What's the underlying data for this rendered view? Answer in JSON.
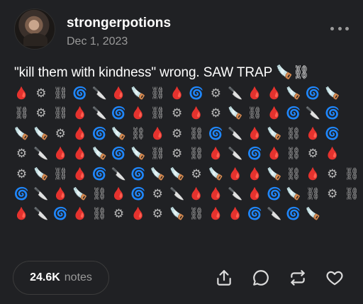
{
  "post": {
    "username": "strongerpotions",
    "date": "Dec 1, 2023",
    "text": "\"kill them with kindness\" wrong. SAW TRAP 🪚⛓",
    "emoji_legend": {
      "drop": "🩸",
      "gear": "⚙",
      "chain": "⛓",
      "spiral": "🌀",
      "knife": "🔪",
      "saw": "🪚"
    },
    "emoji_rows": [
      [
        "drop",
        "gear",
        "chain",
        "spiral",
        "knife",
        "drop",
        "saw",
        "chain",
        "drop",
        "spiral",
        "gear",
        "knife",
        "drop",
        "drop",
        "saw",
        "spiral",
        "saw"
      ],
      [
        "chain",
        "gear",
        "chain",
        "drop",
        "knife",
        "spiral",
        "drop",
        "chain",
        "gear",
        "drop",
        "gear",
        "saw",
        "chain",
        "drop",
        "spiral",
        "knife",
        "spiral"
      ],
      [
        "saw",
        "saw",
        "gear",
        "drop",
        "spiral",
        "saw",
        "chain",
        "drop",
        "gear",
        "chain",
        "spiral",
        "knife",
        "drop",
        "saw",
        "chain",
        "drop",
        "spiral"
      ],
      [
        "gear",
        "knife",
        "drop",
        "drop",
        "saw",
        "spiral",
        "saw",
        "chain",
        "gear",
        "chain",
        "drop",
        "knife",
        "spiral",
        "drop",
        "chain",
        "gear",
        "drop"
      ],
      [
        "gear",
        "saw",
        "chain",
        "drop",
        "spiral",
        "knife",
        "spiral",
        "saw",
        "saw",
        "gear",
        "saw",
        "drop",
        "drop",
        "saw",
        "chain",
        "drop",
        "gear",
        "chain"
      ],
      [
        "spiral",
        "knife",
        "drop",
        "saw",
        "chain",
        "drop",
        "spiral",
        "gear",
        "knife",
        "drop",
        "drop",
        "knife",
        "drop",
        "spiral",
        "saw",
        "chain",
        "gear",
        "chain"
      ],
      [
        "drop",
        "knife",
        "spiral",
        "drop",
        "chain",
        "gear",
        "drop",
        "gear",
        "saw",
        "chain",
        "drop",
        "drop",
        "spiral",
        "knife",
        "spiral",
        "saw"
      ]
    ]
  },
  "footer": {
    "notes_count": "24.6K",
    "notes_label": "notes"
  },
  "icons": {
    "share": "share-icon",
    "reply": "reply-icon",
    "reblog": "reblog-icon",
    "like": "heart-icon",
    "more": "more-icon"
  }
}
